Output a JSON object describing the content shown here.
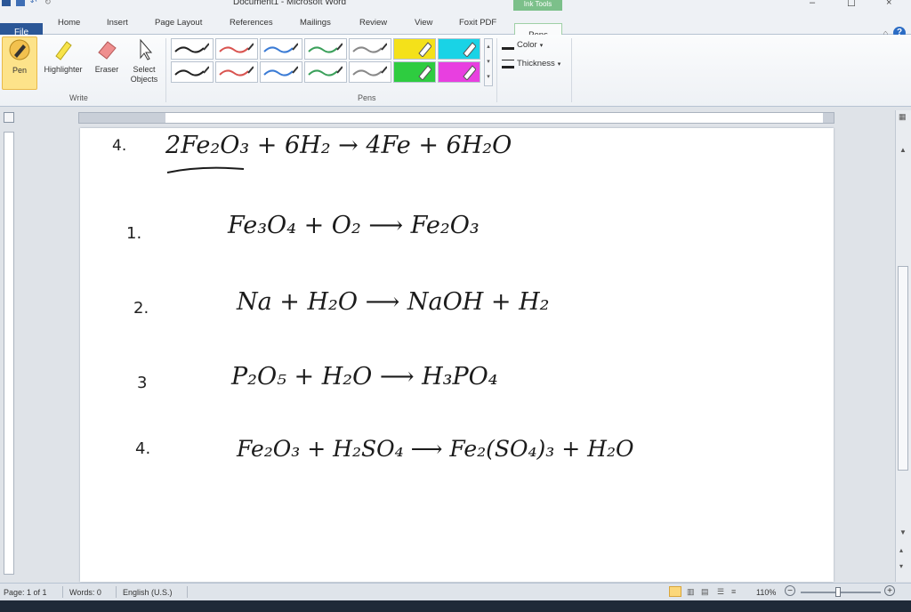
{
  "window": {
    "title": "Document1 - Microsoft Word",
    "contextual_tab_group": "Ink Tools",
    "controls": {
      "minimize": "–",
      "maximize": "☐",
      "close": "×"
    }
  },
  "tabs": [
    {
      "label": "File"
    },
    {
      "label": "Home"
    },
    {
      "label": "Insert"
    },
    {
      "label": "Page Layout"
    },
    {
      "label": "References"
    },
    {
      "label": "Mailings"
    },
    {
      "label": "Review"
    },
    {
      "label": "View"
    },
    {
      "label": "Foxit PDF"
    },
    {
      "label": "Pens"
    }
  ],
  "ribbon": {
    "write_group": {
      "label": "Write",
      "buttons": [
        {
          "label": "Pen",
          "icon": "pen-icon"
        },
        {
          "label": "Highlighter",
          "icon": "highlighter-icon"
        },
        {
          "label": "Eraser",
          "icon": "eraser-icon"
        },
        {
          "label": "Select Objects",
          "label_line1": "Select",
          "label_line2": "Objects",
          "icon": "select-cursor-icon"
        }
      ]
    },
    "pens_group": {
      "label": "Pens",
      "swatch_colors": [
        "#222222",
        "#d9534f",
        "#3a7bd5",
        "#3aa05a",
        "#888888",
        "#f4e11a",
        "#19d3e6",
        "#222222",
        "#d9534f",
        "#3a7bd5",
        "#3aa05a",
        "#888888",
        "#2ecc40",
        "#e83fe0"
      ]
    },
    "options": {
      "color": "Color",
      "thickness": "Thickness"
    }
  },
  "document": {
    "lines": [
      {
        "number": "4.",
        "equation": "2Fe₂O₃ + 6H₂ → 4Fe + 6H₂O"
      },
      {
        "number": "1.",
        "equation": "Fe₃O₄ +     O₂ ⟶     Fe₂O₃"
      },
      {
        "number": "2.",
        "equation": "Na +     H₂O ⟶ NaOH  +     H₂"
      },
      {
        "number": "3",
        "equation": "P₂O₅  +    H₂O ⟶ H₃PO₄"
      },
      {
        "number": "4.",
        "equation": "Fe₂O₃ +    H₂SO₄ ⟶ Fe₂(SO₄)₃ +   H₂O"
      }
    ]
  },
  "statusbar": {
    "page": "Page: 1 of 1",
    "words": "Words: 0",
    "language": "English (U.S.)",
    "zoom": "110%"
  }
}
